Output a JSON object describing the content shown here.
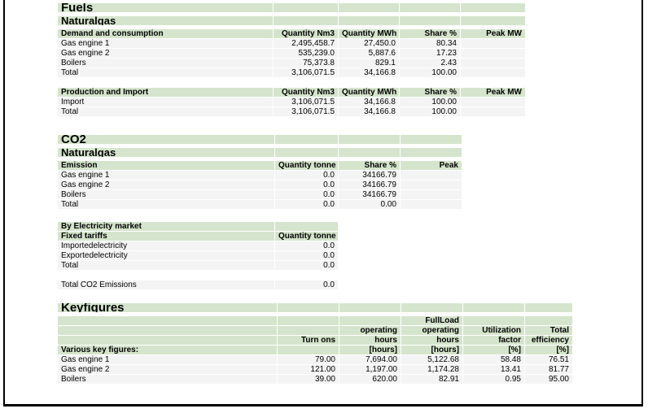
{
  "report": {
    "sections": [
      {
        "id": "fuels",
        "title": "Fuels",
        "subtitle": "Naturalgas",
        "tables": [
          {
            "id": "demand-and-consumption",
            "headers": [
              "Demand and consumption",
              "Quantity Nm3",
              "Quantity MWh",
              "Share %",
              "Peak MW"
            ],
            "rows": [
              [
                "Gas engine 1",
                "2,495,458.7",
                "27,450.0",
                "80.34",
                ""
              ],
              [
                "Gas engine 2",
                "535,239.0",
                "5,887.6",
                "17.23",
                ""
              ],
              [
                "Boilers",
                "75,373.8",
                "829.1",
                "2.43",
                ""
              ],
              [
                "Total",
                "3,106,071.5",
                "34,166.8",
                "100.00",
                ""
              ]
            ]
          },
          {
            "id": "production-and-import",
            "headers": [
              "Production and Import",
              "Quantity Nm3",
              "Quantity MWh",
              "Share %",
              "Peak MW"
            ],
            "rows": [
              [
                "Import",
                "3,106,071.5",
                "34,166.8",
                "100.00",
                ""
              ],
              [
                "Total",
                "3,106,071.5",
                "34,166.8",
                "100.00",
                ""
              ]
            ]
          }
        ]
      },
      {
        "id": "co2",
        "title": "CO2",
        "subtitle": "Naturalgas",
        "tables": [
          {
            "id": "emission",
            "headers": [
              "Emission",
              "Quantity tonne",
              "Share %",
              "Peak"
            ],
            "rows": [
              [
                "Gas engine 1",
                "0.0",
                "34166.79",
                ""
              ],
              [
                "Gas engine 2",
                "0.0",
                "34166.79",
                ""
              ],
              [
                "Boilers",
                "0.0",
                "34166.79",
                ""
              ],
              [
                "Total",
                "0.0",
                "0.00",
                ""
              ]
            ]
          },
          {
            "id": "by-electricity-market",
            "group_label": "By Electricity market",
            "headers": [
              "Fixed tariffs",
              "Quantity tonne"
            ],
            "rows": [
              [
                "Importedelectricity",
                "0.0"
              ],
              [
                "Exportedelectricity",
                "0.0"
              ],
              [
                "Total",
                "0.0"
              ]
            ],
            "footer": [
              "Total CO2 Emissions",
              "0.0"
            ]
          }
        ]
      },
      {
        "id": "keyfigures",
        "title": "Keyfigures",
        "tables": [
          {
            "id": "various-key-figures",
            "header_lines": [
              [
                "",
                "",
                "",
                "FullLoad",
                "",
                ""
              ],
              [
                "",
                "",
                "operating",
                "operating",
                "Utilization",
                "Total"
              ],
              [
                "",
                "Turn ons",
                "hours",
                "hours",
                "factor",
                "efficiency"
              ],
              [
                "Various key figures:",
                "",
                "[hours]",
                "[hours]",
                "[%]",
                "[%]"
              ]
            ],
            "rows": [
              [
                "Gas engine 1",
                "79.00",
                "7,694.00",
                "5,122.68",
                "58.48",
                "76.51"
              ],
              [
                "Gas engine 2",
                "121.00",
                "1,197.00",
                "1,174.28",
                "13.41",
                "81.77"
              ],
              [
                "Boilers",
                "39.00",
                "620.00",
                "82.91",
                "0.95",
                "95.00"
              ]
            ]
          }
        ]
      }
    ]
  },
  "colors": {
    "header_green": "#d5e5cd",
    "data_row": "#f4f4f4",
    "gridline": "#ffffff",
    "page_border": "#000000"
  }
}
